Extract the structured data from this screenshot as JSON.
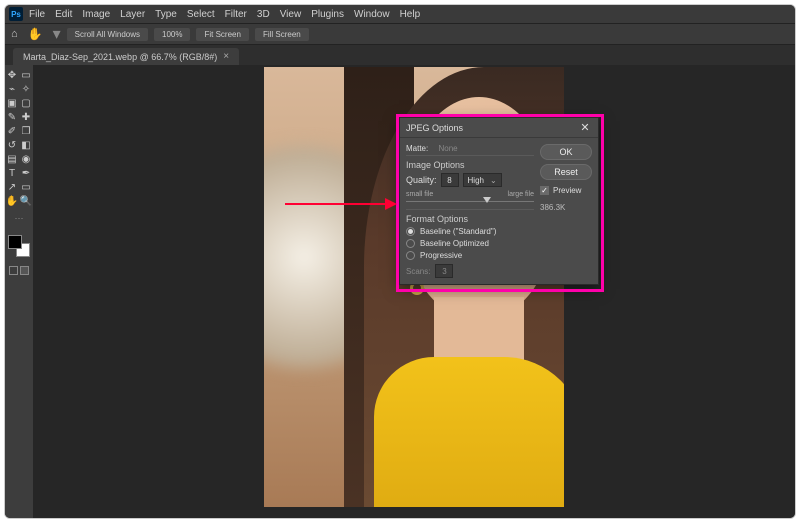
{
  "menu": {
    "ps": "Ps",
    "items": [
      "File",
      "Edit",
      "Image",
      "Layer",
      "Type",
      "Select",
      "Filter",
      "3D",
      "View",
      "Plugins",
      "Window",
      "Help"
    ]
  },
  "options": {
    "scroll": "Scroll All Windows",
    "zoom": "100%",
    "fit": "Fit Screen",
    "fill": "Fill Screen"
  },
  "tab": {
    "label": "Marta_Diaz-Sep_2021.webp @ 66.7% (RGB/8#)",
    "close": "×"
  },
  "dialog": {
    "title": "JPEG Options",
    "tabs": {
      "matte": "Matte:",
      "none": "None"
    },
    "image_options": "Image Options",
    "quality_label": "Quality:",
    "quality_value": "8",
    "quality_preset": "High",
    "small_file": "small file",
    "large_file": "large file",
    "format_options": "Format Options",
    "baseline_std": "Baseline (\"Standard\")",
    "baseline_opt": "Baseline Optimized",
    "progressive": "Progressive",
    "scans_label": "Scans:",
    "scans_value": "3",
    "ok": "OK",
    "reset": "Reset",
    "preview": "Preview",
    "filesize": "386.3K"
  }
}
